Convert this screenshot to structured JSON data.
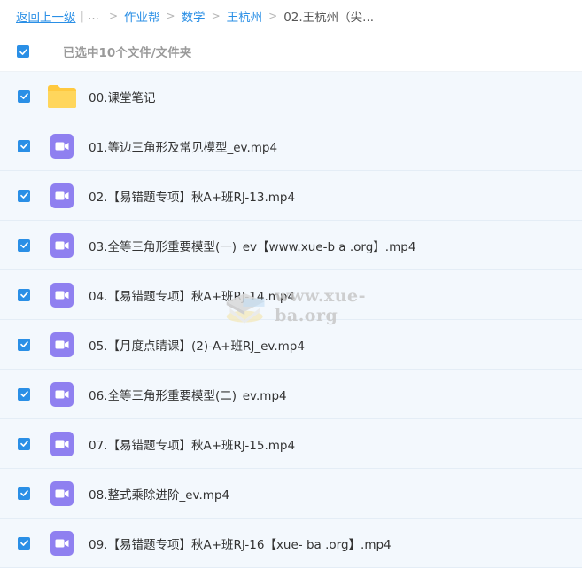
{
  "breadcrumb": {
    "back_label": "返回上一级",
    "separator": "|",
    "ellipsis": "...",
    "arrow": ">",
    "items": [
      "作业帮",
      "数学",
      "王杭州"
    ],
    "current": "02.王杭州（尖..."
  },
  "selection": {
    "count_text": "已选中10个文件/文件夹",
    "checked": true
  },
  "files": [
    {
      "name": "00.课堂笔记",
      "type": "folder",
      "checked": true
    },
    {
      "name": "01.等边三角形及常见模型_ev.mp4",
      "type": "video",
      "checked": true
    },
    {
      "name": "02.【易错题专项】秋A+班RJ-13.mp4",
      "type": "video",
      "checked": true
    },
    {
      "name": "03.全等三角形重要模型(一)_ev【www.xue-b a .org】.mp4",
      "type": "video",
      "checked": true
    },
    {
      "name": "04.【易错题专项】秋A+班RJ-14.mp4",
      "type": "video",
      "checked": true
    },
    {
      "name": "05.【月度点睛课】(2)-A+班RJ_ev.mp4",
      "type": "video",
      "checked": true
    },
    {
      "name": "06.全等三角形重要模型(二)_ev.mp4",
      "type": "video",
      "checked": true
    },
    {
      "name": "07.【易错题专项】秋A+班RJ-15.mp4",
      "type": "video",
      "checked": true
    },
    {
      "name": "08.整式乘除进阶_ev.mp4",
      "type": "video",
      "checked": true
    },
    {
      "name": "09.【易错题专项】秋A+班RJ-16【xue- ba .org】.mp4",
      "type": "video",
      "checked": true
    }
  ],
  "watermark": {
    "text": "www.xue-ba.org"
  },
  "colors": {
    "accent": "#2a8fe6",
    "row_bg": "#f3f8fd",
    "video_icon": "#8f80f0",
    "folder_icon": "#ffc93f"
  },
  "icons": {
    "folder": "folder-icon",
    "video": "video-file-icon",
    "checkbox": "checkbox-checked-icon"
  }
}
